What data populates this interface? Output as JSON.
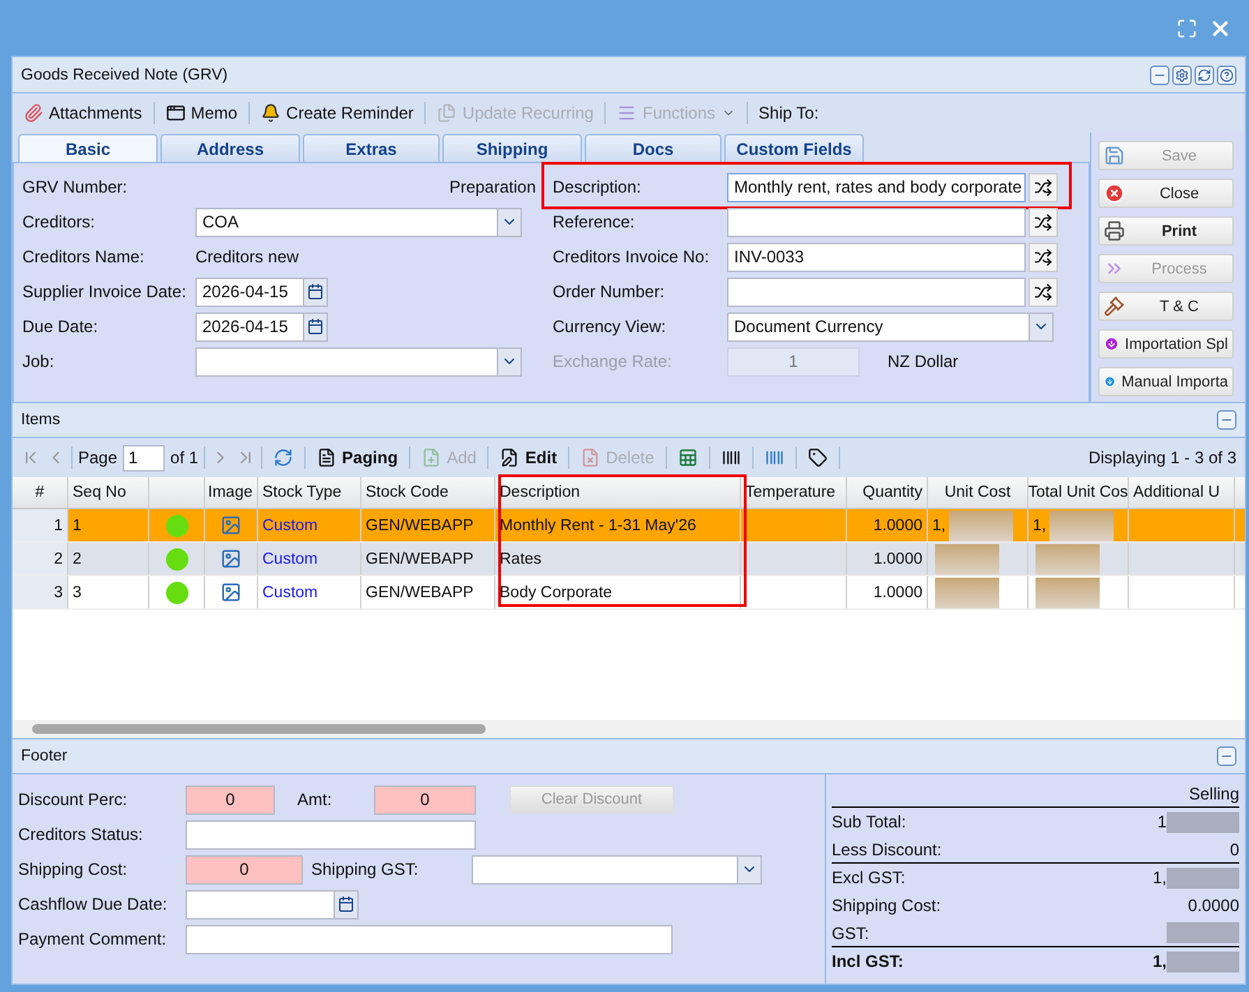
{
  "panel": {
    "title": "Goods Received Note (GRV)"
  },
  "toolbar": [
    {
      "kind": "button",
      "label": "Attachments",
      "disabled": false
    },
    {
      "kind": "button",
      "label": "Memo",
      "disabled": false
    },
    {
      "kind": "button",
      "label": "Create Reminder",
      "disabled": false
    },
    {
      "kind": "button",
      "label": "Update Recurring",
      "disabled": true
    },
    {
      "kind": "menu",
      "label": "Functions",
      "disabled": true
    },
    {
      "kind": "text",
      "label": "Ship To:"
    }
  ],
  "tabs": [
    {
      "label": "Basic",
      "selected": true
    },
    {
      "label": "Address",
      "selected": false
    },
    {
      "label": "Extras",
      "selected": false
    },
    {
      "label": "Shipping",
      "selected": false
    },
    {
      "label": "Docs",
      "selected": false
    },
    {
      "label": "Custom Fields",
      "selected": false
    }
  ],
  "form_left": [
    {
      "kind": "status",
      "label": "GRV Number:",
      "value": "Preparation"
    },
    {
      "kind": "combo",
      "label": "Creditors:",
      "value": "COA"
    },
    {
      "kind": "text",
      "label": "Creditors Name:",
      "value": "Creditors new"
    },
    {
      "kind": "date",
      "label": "Supplier Invoice Date:",
      "value": "2026-04-15"
    },
    {
      "kind": "date",
      "label": "Due Date:",
      "value": "2026-04-15"
    },
    {
      "kind": "combo",
      "label": "Job:"
    }
  ],
  "form_right": [
    {
      "kind": "shuffle",
      "label": "Description:",
      "value": "Monthly rent, rates and body corporate",
      "highlighted": true
    },
    {
      "kind": "shuffle",
      "label": "Reference:",
      "highlighted": false
    },
    {
      "kind": "shuffle",
      "label": "Creditors Invoice No:",
      "value": "INV-0033",
      "highlighted": false
    },
    {
      "kind": "shuffle",
      "label": "Order Number:",
      "highlighted": false
    },
    {
      "kind": "combo",
      "label": "Currency View:",
      "value": "Document Currency"
    },
    {
      "kind": "rate",
      "label": "Exchange Rate:",
      "value": "1",
      "unit": "NZ Dollar",
      "disabled": true
    }
  ],
  "actions": [
    {
      "label": "Save",
      "disabled": true,
      "bold": false
    },
    {
      "label": "Close",
      "disabled": false,
      "bold": false
    },
    {
      "label": "Print",
      "disabled": false,
      "bold": true
    },
    {
      "label": "Process",
      "disabled": true,
      "bold": false
    },
    {
      "label": "T & C",
      "disabled": false,
      "bold": false
    },
    {
      "label": "Importation Spl",
      "disabled": false,
      "bold": false
    },
    {
      "label": "Manual Importa",
      "disabled": false,
      "bold": false
    }
  ],
  "items": {
    "title": "Items",
    "page_label": "Page",
    "page": "1",
    "page_of": "of 1",
    "tools": [
      {
        "disabled": false
      },
      {
        "label": "Paging",
        "disabled": false
      },
      {
        "label": "Add",
        "disabled": true
      },
      {
        "label": "Edit",
        "disabled": false
      },
      {
        "label": "Delete",
        "disabled": true
      },
      {
        "disabled": false
      },
      {
        "disabled": false
      },
      {
        "disabled": false
      },
      {
        "disabled": false
      }
    ],
    "displaying": "Displaying 1 - 3 of 3",
    "columns": [
      {
        "label": "#"
      },
      {
        "label": "Seq No"
      },
      {},
      {
        "label": "Image"
      },
      {
        "label": "Stock Type"
      },
      {
        "label": "Stock Code"
      },
      {
        "label": "Description",
        "highlighted": true
      },
      {
        "label": "Temperature"
      },
      {
        "label": "Quantity"
      },
      {
        "label": "Unit Cost"
      },
      {
        "label": "Total Unit Cos"
      },
      {
        "label": "Additional U"
      }
    ],
    "rows": [
      {
        "index": "1",
        "seq": "1",
        "selected": true,
        "color": "#66dd11",
        "stock_type": "Custom",
        "stock_code": "GEN/WEBAPP",
        "description": "Monthly Rent - 1-31 May'26",
        "quantity": "1.0000",
        "unit_cost": "1,",
        "total_unit_cost": "1,"
      },
      {
        "index": "2",
        "seq": "2",
        "selected": false,
        "color": "#66dd11",
        "stock_type": "Custom",
        "stock_code": "GEN/WEBAPP",
        "description": "Rates",
        "quantity": "1.0000"
      },
      {
        "index": "3",
        "seq": "3",
        "selected": false,
        "color": "#66dd11",
        "stock_type": "Custom",
        "stock_code": "GEN/WEBAPP",
        "description": "Body Corporate",
        "quantity": "1.0000"
      }
    ]
  },
  "footer": {
    "title": "Footer",
    "discount_label": "Discount Perc:",
    "discount": "0",
    "amt_label": "Amt:",
    "amt": "0",
    "clear_discount": {
      "label": "Clear Discount",
      "disabled": true
    },
    "status_label": "Creditors Status:",
    "shipping_label": "Shipping Cost:",
    "shipping": "0",
    "shipping_gst_label": "Shipping GST:",
    "cashflow_label": "Cashflow Due Date:",
    "comment_label": "Payment Comment:",
    "summary": {
      "heading": "Selling",
      "lines": [
        {
          "label": "Sub Total:",
          "value": "1",
          "masked": true,
          "bold": false,
          "rule": false
        },
        {
          "label": "Less Discount:",
          "value": "0",
          "masked": false,
          "bold": false,
          "rule": true
        },
        {
          "label": "Excl GST:",
          "value": "1,",
          "masked": true,
          "bold": false,
          "rule": false
        },
        {
          "label": "Shipping Cost:",
          "value": "0.0000",
          "masked": false,
          "bold": false,
          "rule": false
        },
        {
          "label": "GST:",
          "masked": true,
          "bold": false,
          "rule": true
        },
        {
          "label": "Incl GST:",
          "value": "1,",
          "masked": true,
          "bold": true,
          "rule": false
        }
      ]
    }
  }
}
